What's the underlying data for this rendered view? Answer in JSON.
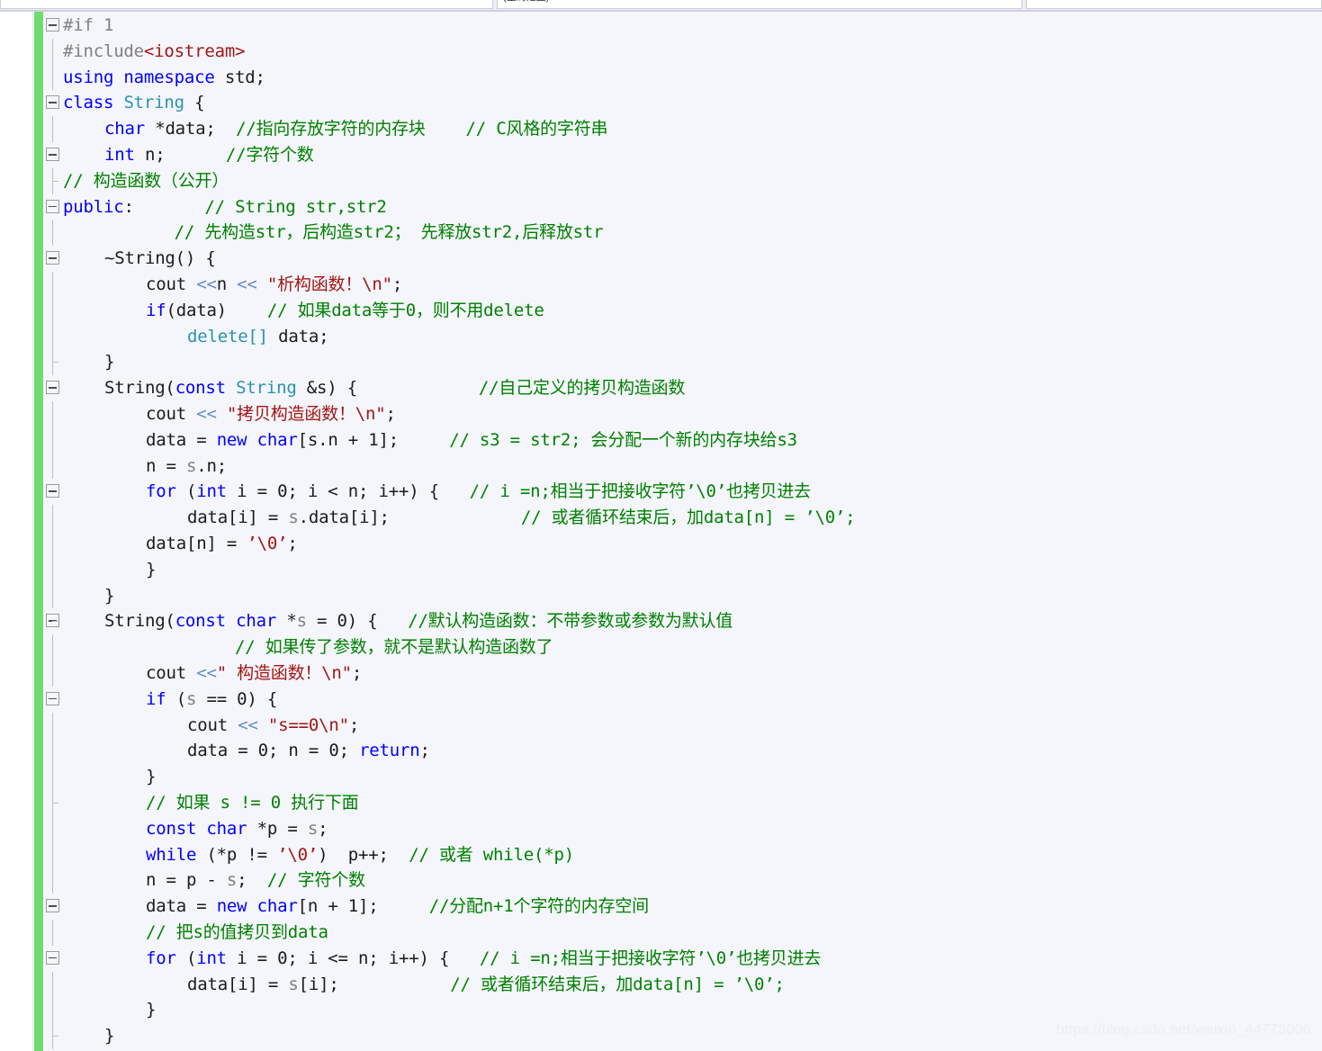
{
  "nav_bar": {
    "scope_combo": "",
    "member_combo": "(全局范围)",
    "extra_combo": ""
  },
  "editor": {
    "background": "#f4f6fb",
    "change_bar_color": "#6fdc6f",
    "font_size_px": 19,
    "line_height_px": 28.8,
    "colors": {
      "keyword": "#0000ff",
      "type": "#2b91af",
      "string": "#a31515",
      "comment": "#008000",
      "preprocessor_dim": "#808080",
      "plain": "#1b1b1b"
    },
    "lines": [
      {
        "indent": 0,
        "fold": "box",
        "tokens": [
          {
            "t": "#if 1",
            "c": "pp"
          }
        ]
      },
      {
        "indent": 0,
        "fold": "line",
        "tokens": [
          {
            "t": "#include",
            "c": "pp"
          },
          {
            "t": "<iostream>",
            "c": "ppr"
          }
        ]
      },
      {
        "indent": 0,
        "fold": "line",
        "tokens": [
          {
            "t": "using namespace ",
            "c": "kw"
          },
          {
            "t": "std;",
            "c": "pl"
          }
        ]
      },
      {
        "indent": 0,
        "fold": "box",
        "tokens": [
          {
            "t": "class ",
            "c": "kw"
          },
          {
            "t": "String",
            "c": "typ"
          },
          {
            "t": " {",
            "c": "pl"
          }
        ]
      },
      {
        "indent": 1,
        "fold": "line",
        "tokens": [
          {
            "t": "char",
            "c": "kw"
          },
          {
            "t": " *data;  ",
            "c": "pl"
          },
          {
            "t": "//指向存放字符的内存块    // C风格的字符串",
            "c": "cmt"
          }
        ]
      },
      {
        "indent": 1,
        "fold": "box",
        "tokens": [
          {
            "t": "int",
            "c": "kw"
          },
          {
            "t": " n;      ",
            "c": "pl"
          },
          {
            "t": "//字符个数",
            "c": "cmt"
          }
        ]
      },
      {
        "indent": 0,
        "fold": "line",
        "tokens": [
          {
            "t": "// 构造函数（公开）",
            "c": "cmt"
          }
        ]
      },
      {
        "indent": 0,
        "fold": "box",
        "tokens": [
          {
            "t": "public",
            "c": "kw"
          },
          {
            "t": ":       ",
            "c": "pl"
          },
          {
            "t": "// String str,str2",
            "c": "cmt"
          }
        ]
      },
      {
        "indent": 0,
        "fold": "line",
        "tokens": [
          {
            "t": "           // 先构造str，后构造str2； 先释放str2,后释放str",
            "c": "cmt"
          }
        ]
      },
      {
        "indent": 1,
        "fold": "box",
        "tokens": [
          {
            "t": "~String() {",
            "c": "pl"
          }
        ]
      },
      {
        "indent": 2,
        "fold": "line",
        "tokens": [
          {
            "t": "cout ",
            "c": "pl"
          },
          {
            "t": "<<",
            "c": "op"
          },
          {
            "t": "n ",
            "c": "pl"
          },
          {
            "t": "<< ",
            "c": "op"
          },
          {
            "t": "\"析构函数！\\n\"",
            "c": "str"
          },
          {
            "t": ";",
            "c": "pl"
          }
        ]
      },
      {
        "indent": 2,
        "fold": "line",
        "tokens": [
          {
            "t": "if",
            "c": "kw"
          },
          {
            "t": "(data)    ",
            "c": "pl"
          },
          {
            "t": "// 如果data等于0，则不用delete",
            "c": "cmt"
          }
        ]
      },
      {
        "indent": 3,
        "fold": "line",
        "tokens": [
          {
            "t": "delete[]",
            "c": "typ"
          },
          {
            "t": " data;",
            "c": "pl"
          }
        ]
      },
      {
        "indent": 1,
        "fold": "line",
        "tokens": [
          {
            "t": "}",
            "c": "pl"
          }
        ]
      },
      {
        "indent": 1,
        "fold": "box",
        "tokens": [
          {
            "t": "String(",
            "c": "pl"
          },
          {
            "t": "const ",
            "c": "kw"
          },
          {
            "t": "String",
            "c": "typ"
          },
          {
            "t": " &s) {            ",
            "c": "pl"
          },
          {
            "t": "//自己定义的拷贝构造函数",
            "c": "cmt"
          }
        ]
      },
      {
        "indent": 2,
        "fold": "line",
        "tokens": [
          {
            "t": "cout ",
            "c": "pl"
          },
          {
            "t": "<< ",
            "c": "op"
          },
          {
            "t": "\"拷贝构造函数！\\n\"",
            "c": "str"
          },
          {
            "t": ";",
            "c": "pl"
          }
        ]
      },
      {
        "indent": 2,
        "fold": "line",
        "tokens": [
          {
            "t": "data = ",
            "c": "pl"
          },
          {
            "t": "new char",
            "c": "kw"
          },
          {
            "t": "[s.n + 1];     ",
            "c": "pl"
          },
          {
            "t": "// s3 = str2; 会分配一个新的内存块给s3",
            "c": "cmt"
          }
        ]
      },
      {
        "indent": 2,
        "fold": "line",
        "tokens": [
          {
            "t": "n = ",
            "c": "pl"
          },
          {
            "t": "s",
            "c": "var"
          },
          {
            "t": ".n;",
            "c": "pl"
          }
        ]
      },
      {
        "indent": 2,
        "fold": "box",
        "tokens": [
          {
            "t": "for",
            "c": "kw"
          },
          {
            "t": " (",
            "c": "pl"
          },
          {
            "t": "int",
            "c": "kw"
          },
          {
            "t": " i = 0; i < n; i++) {   ",
            "c": "pl"
          },
          {
            "t": "// i =n;相当于把接收字符’\\0’也拷贝进去",
            "c": "cmt"
          }
        ]
      },
      {
        "indent": 3,
        "fold": "line",
        "tokens": [
          {
            "t": "data[i] = ",
            "c": "pl"
          },
          {
            "t": "s",
            "c": "var"
          },
          {
            "t": ".data[i];             ",
            "c": "pl"
          },
          {
            "t": "// 或者循环结束后，加data[n] = ’\\0’;",
            "c": "cmt"
          }
        ]
      },
      {
        "indent": 2,
        "fold": "line",
        "tokens": [
          {
            "t": "data[n] = ",
            "c": "pl"
          },
          {
            "t": "’\\0’",
            "c": "str"
          },
          {
            "t": ";",
            "c": "pl"
          }
        ]
      },
      {
        "indent": 2,
        "fold": "line",
        "tokens": [
          {
            "t": "}",
            "c": "pl"
          }
        ]
      },
      {
        "indent": 1,
        "fold": "line",
        "tokens": [
          {
            "t": "}",
            "c": "pl"
          }
        ]
      },
      {
        "indent": 1,
        "fold": "box",
        "tokens": [
          {
            "t": "String(",
            "c": "pl"
          },
          {
            "t": "const char",
            "c": "kw"
          },
          {
            "t": " *",
            "c": "pl"
          },
          {
            "t": "s",
            "c": "var"
          },
          {
            "t": " = 0) {   ",
            "c": "pl"
          },
          {
            "t": "//默认构造函数：不带参数或参数为默认值",
            "c": "cmt"
          }
        ]
      },
      {
        "indent": 0,
        "fold": "line",
        "tokens": [
          {
            "t": "                 // 如果传了参数，就不是默认构造函数了",
            "c": "cmt"
          }
        ]
      },
      {
        "indent": 2,
        "fold": "line",
        "tokens": [
          {
            "t": "cout ",
            "c": "pl"
          },
          {
            "t": "<<",
            "c": "op"
          },
          {
            "t": "\" 构造函数！\\n\"",
            "c": "str"
          },
          {
            "t": ";",
            "c": "pl"
          }
        ]
      },
      {
        "indent": 2,
        "fold": "box",
        "tokens": [
          {
            "t": "if",
            "c": "kw"
          },
          {
            "t": " (",
            "c": "pl"
          },
          {
            "t": "s",
            "c": "var"
          },
          {
            "t": " == 0) {",
            "c": "pl"
          }
        ]
      },
      {
        "indent": 3,
        "fold": "line",
        "tokens": [
          {
            "t": "cout ",
            "c": "pl"
          },
          {
            "t": "<< ",
            "c": "op"
          },
          {
            "t": "\"s==0\\n\"",
            "c": "str"
          },
          {
            "t": ";",
            "c": "pl"
          }
        ]
      },
      {
        "indent": 3,
        "fold": "line",
        "tokens": [
          {
            "t": "data = 0; n = 0; ",
            "c": "pl"
          },
          {
            "t": "return",
            "c": "kw"
          },
          {
            "t": ";",
            "c": "pl"
          }
        ]
      },
      {
        "indent": 2,
        "fold": "line",
        "tokens": [
          {
            "t": "}",
            "c": "pl"
          }
        ]
      },
      {
        "indent": 2,
        "fold": "line",
        "tokens": [
          {
            "t": "// 如果 s != 0 执行下面",
            "c": "cmt"
          }
        ]
      },
      {
        "indent": 2,
        "fold": "line",
        "tokens": [
          {
            "t": "const char",
            "c": "kw"
          },
          {
            "t": " *p = ",
            "c": "pl"
          },
          {
            "t": "s",
            "c": "var"
          },
          {
            "t": ";",
            "c": "pl"
          }
        ]
      },
      {
        "indent": 2,
        "fold": "line",
        "tokens": [
          {
            "t": "while",
            "c": "kw"
          },
          {
            "t": " (*p != ",
            "c": "pl"
          },
          {
            "t": "’\\0’",
            "c": "str"
          },
          {
            "t": ")  p++;  ",
            "c": "pl"
          },
          {
            "t": "// 或者 while(*p)",
            "c": "cmt"
          }
        ]
      },
      {
        "indent": 2,
        "fold": "line",
        "tokens": [
          {
            "t": "n = p - ",
            "c": "pl"
          },
          {
            "t": "s",
            "c": "var"
          },
          {
            "t": ";  ",
            "c": "pl"
          },
          {
            "t": "// 字符个数",
            "c": "cmt"
          }
        ]
      },
      {
        "indent": 2,
        "fold": "box",
        "tokens": [
          {
            "t": "data = ",
            "c": "pl"
          },
          {
            "t": "new char",
            "c": "kw"
          },
          {
            "t": "[n + 1];     ",
            "c": "pl"
          },
          {
            "t": "//分配n+1个字符的内存空间",
            "c": "cmt"
          }
        ]
      },
      {
        "indent": 2,
        "fold": "line",
        "tokens": [
          {
            "t": "// 把s的值拷贝到data",
            "c": "cmt"
          }
        ]
      },
      {
        "indent": 2,
        "fold": "box",
        "tokens": [
          {
            "t": "for",
            "c": "kw"
          },
          {
            "t": " (",
            "c": "pl"
          },
          {
            "t": "int",
            "c": "kw"
          },
          {
            "t": " i = 0; i <= n; i++) {   ",
            "c": "pl"
          },
          {
            "t": "// i =n;相当于把接收字符’\\0’也拷贝进去",
            "c": "cmt"
          }
        ]
      },
      {
        "indent": 3,
        "fold": "line",
        "tokens": [
          {
            "t": "data[i] = ",
            "c": "pl"
          },
          {
            "t": "s",
            "c": "var"
          },
          {
            "t": "[i];           ",
            "c": "pl"
          },
          {
            "t": "// 或者循环结束后，加data[n] = ’\\0’;",
            "c": "cmt"
          }
        ]
      },
      {
        "indent": 2,
        "fold": "line",
        "tokens": [
          {
            "t": "}",
            "c": "pl"
          }
        ]
      },
      {
        "indent": 1,
        "fold": "line",
        "tokens": [
          {
            "t": "}",
            "c": "pl"
          }
        ]
      }
    ]
  },
  "watermark": {
    "text": "https://blog.csdn.net/weixin_44773006"
  }
}
